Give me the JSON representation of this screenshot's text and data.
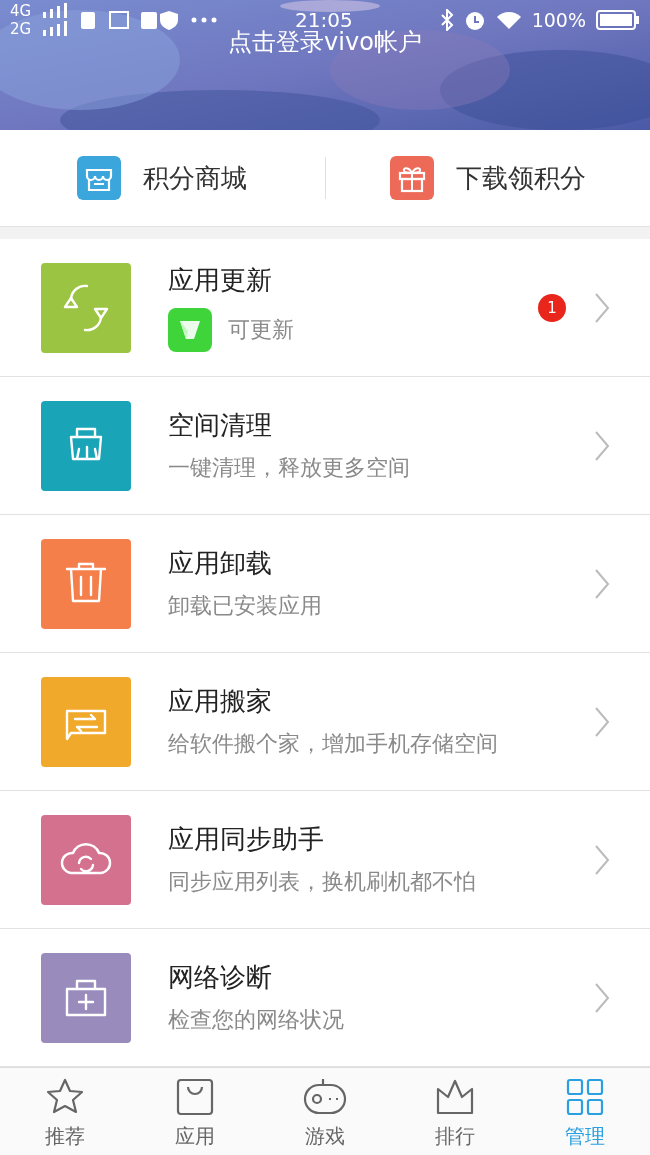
{
  "status_bar": {
    "network_1": "4G",
    "network_2": "2G",
    "time": "21:05",
    "battery": "100%"
  },
  "header": {
    "login_link": "点击登录vivo帐户"
  },
  "shortcuts": [
    {
      "label": "积分商城",
      "kind": "store",
      "color": "#3aa6dc"
    },
    {
      "label": "下载领积分",
      "kind": "gift",
      "color": "#ee6a58"
    }
  ],
  "tools": [
    {
      "title": "应用更新",
      "kind": "update",
      "subtitle": "可更新",
      "badge": "1",
      "color": "#9bc442"
    },
    {
      "title": "空间清理",
      "kind": "clean",
      "subtitle": "一键清理，释放更多空间",
      "color": "#1aa4b8"
    },
    {
      "title": "应用卸载",
      "kind": "uninstall",
      "subtitle": "卸载已安装应用",
      "color": "#f47f4b"
    },
    {
      "title": "应用搬家",
      "kind": "move",
      "subtitle": "给软件搬个家，增加手机存储空间",
      "color": "#f0a92a"
    },
    {
      "title": "应用同步助手",
      "kind": "sync",
      "subtitle": "同步应用列表，换机刷机都不怕",
      "color": "#d4718f"
    },
    {
      "title": "网络诊断",
      "kind": "network",
      "subtitle": "检查您的网络状况",
      "color": "#9a8bbd"
    }
  ],
  "tab_bar": [
    {
      "label": "推荐",
      "kind": "star",
      "selected": false
    },
    {
      "label": "应用",
      "kind": "bag",
      "selected": false
    },
    {
      "label": "游戏",
      "kind": "gamepad",
      "selected": false
    },
    {
      "label": "排行",
      "kind": "crown",
      "selected": false
    },
    {
      "label": "管理",
      "kind": "grid",
      "selected": true
    }
  ]
}
